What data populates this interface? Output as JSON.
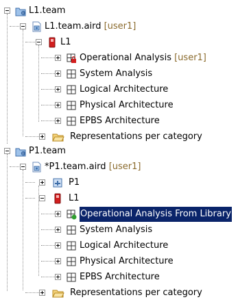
{
  "tree": {
    "nodes": [
      {
        "label": "L1.team",
        "suffix": ""
      },
      {
        "label": "L1.team.aird",
        "suffix": "[user1]"
      },
      {
        "label": "L1",
        "suffix": ""
      },
      {
        "label": "Operational Analysis",
        "suffix": "[user1]"
      },
      {
        "label": "System Analysis",
        "suffix": ""
      },
      {
        "label": "Logical Architecture",
        "suffix": ""
      },
      {
        "label": "Physical Architecture",
        "suffix": ""
      },
      {
        "label": "EPBS Architecture",
        "suffix": ""
      },
      {
        "label": "Representations per category",
        "suffix": ""
      },
      {
        "label": "P1.team",
        "suffix": ""
      },
      {
        "label": "*P1.team.aird",
        "suffix": "[user1]"
      },
      {
        "label": "P1",
        "suffix": ""
      },
      {
        "label": "L1",
        "suffix": ""
      },
      {
        "label": "Operational Analysis From Library",
        "suffix": ""
      },
      {
        "label": "System Analysis",
        "suffix": ""
      },
      {
        "label": "Logical Architecture",
        "suffix": ""
      },
      {
        "label": "Physical Architecture",
        "suffix": ""
      },
      {
        "label": "EPBS Architecture",
        "suffix": ""
      },
      {
        "label": "Representations per category",
        "suffix": ""
      }
    ],
    "icons": [
      "team-project-icon",
      "aird-file-icon",
      "library-book-icon",
      "operational-locked-icon",
      "system-analysis-icon",
      "logical-architecture-icon",
      "physical-architecture-icon",
      "epbs-architecture-icon",
      "folder-icon",
      "team-project-icon",
      "aird-file-icon",
      "project-icon",
      "library-book-icon",
      "operational-library-icon",
      "system-analysis-icon",
      "logical-architecture-icon",
      "physical-architecture-icon",
      "epbs-architecture-icon",
      "folder-icon"
    ],
    "selected_index": 13
  },
  "colors": {
    "selection": "#0a246a",
    "user_tag": "#8a6a2c",
    "lock_red": "#d21e1e",
    "library_green": "#2f9e2f"
  }
}
